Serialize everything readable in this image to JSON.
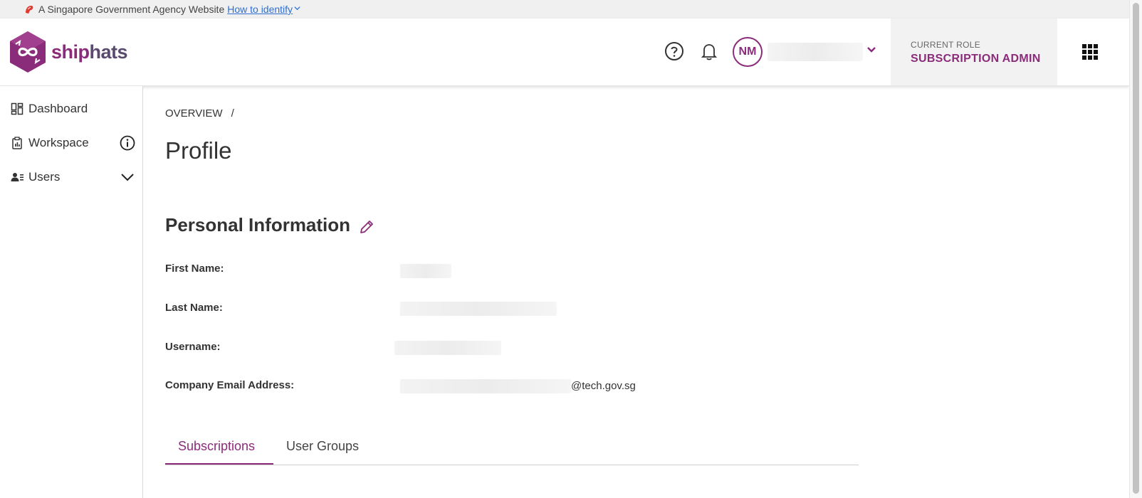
{
  "masthead": {
    "text": "A Singapore Government Agency Website",
    "link": "How to identify"
  },
  "header": {
    "brand_part1": "ship",
    "brand_part2": "hats",
    "avatar_initials": "NM",
    "role_label": "CURRENT ROLE",
    "role_value": "SUBSCRIPTION ADMIN",
    "icons": [
      "help-icon",
      "bell-icon",
      "chevron-down-icon",
      "apps-grid-icon"
    ]
  },
  "sidebar": {
    "items": [
      {
        "label": "Dashboard",
        "icon": "dashboard-icon"
      },
      {
        "label": "Workspace",
        "icon": "clipboard-icon",
        "aux_icon": "info-icon"
      },
      {
        "label": "Users",
        "icon": "users-icon",
        "aux_icon": "chevron-down-icon"
      }
    ]
  },
  "main": {
    "breadcrumb": {
      "item": "OVERVIEW",
      "separator": "/"
    },
    "title": "Profile",
    "section_title": "Personal Information",
    "fields": [
      {
        "label": "First Name:"
      },
      {
        "label": "Last Name:"
      },
      {
        "label": "Username:"
      },
      {
        "label": "Company Email Address:",
        "value_suffix": "@tech.gov.sg"
      }
    ],
    "tabs": [
      {
        "label": "Subscriptions",
        "active": true
      },
      {
        "label": "User Groups",
        "active": false
      }
    ]
  },
  "colors": {
    "accent": "#8b2c7b",
    "masthead_bg": "#f0f0f0",
    "role_bg": "#f2f2f2"
  }
}
